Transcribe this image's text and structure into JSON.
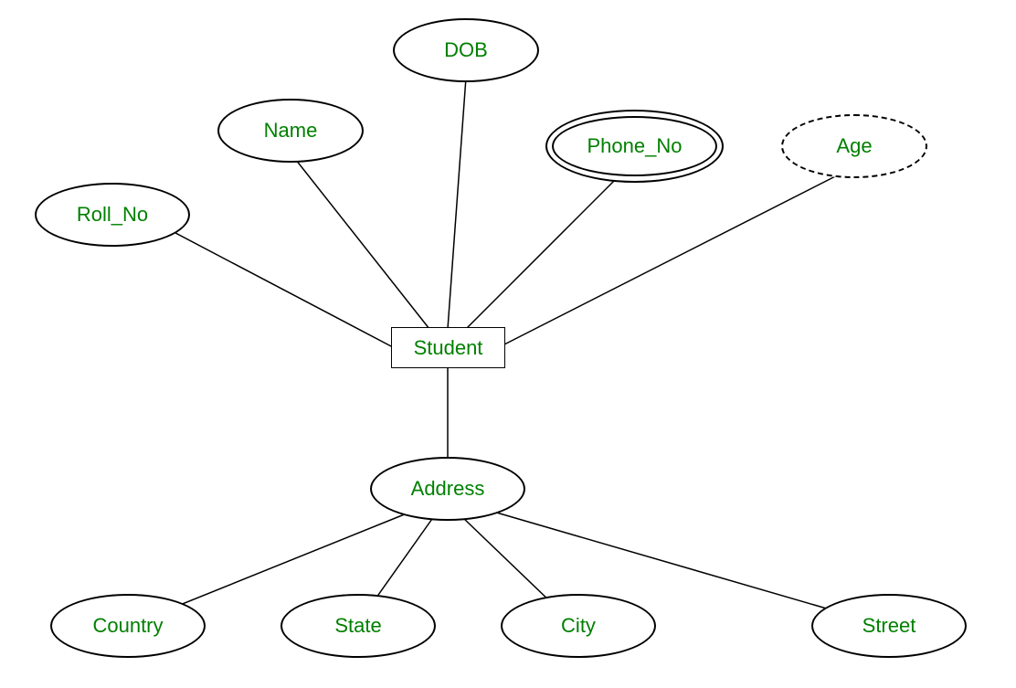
{
  "diagram": {
    "type": "er-diagram",
    "entity": {
      "label": "Student"
    },
    "attributes": {
      "dob": "DOB",
      "name": "Name",
      "phone_no": "Phone_No",
      "age": "Age",
      "roll_no": "Roll_No",
      "address": "Address",
      "country": "Country",
      "state": "State",
      "city": "City",
      "street": "Street"
    },
    "attribute_types": {
      "dob": "simple",
      "name": "simple",
      "phone_no": "multivalued",
      "age": "derived",
      "roll_no": "simple",
      "address": "composite",
      "country": "simple",
      "state": "simple",
      "city": "simple",
      "street": "simple"
    }
  }
}
